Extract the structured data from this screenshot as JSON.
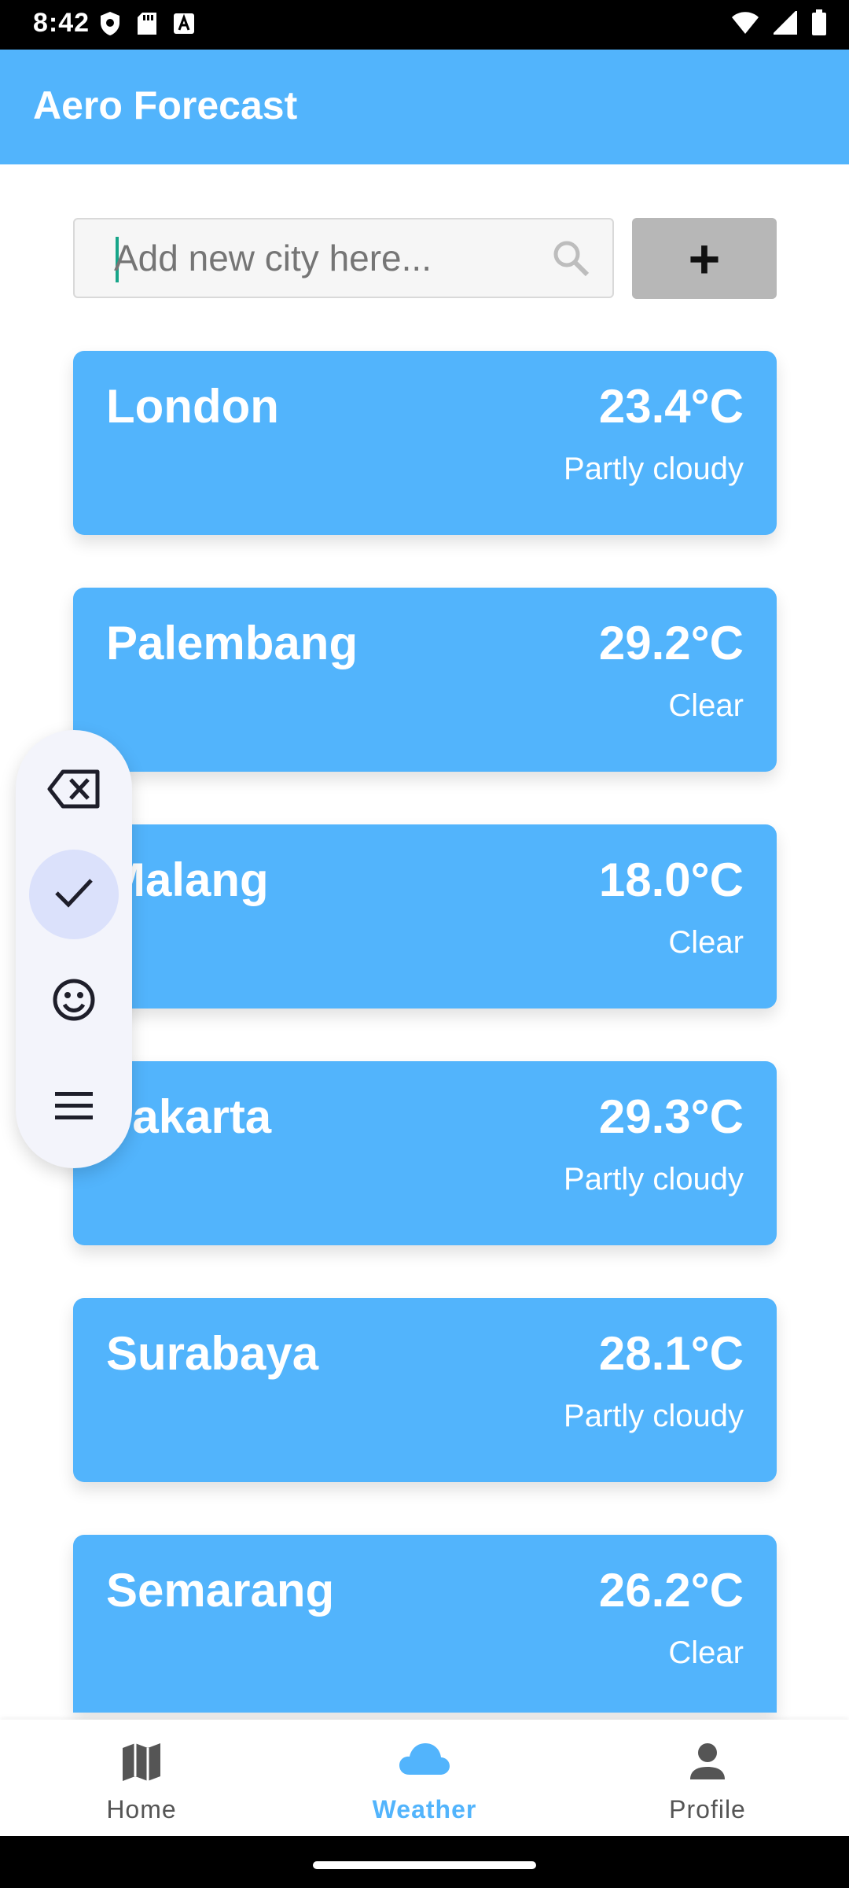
{
  "status_bar": {
    "time": "8:42",
    "left_icons": [
      "shield-icon",
      "sd-card-icon",
      "font-a-icon"
    ],
    "right_icons": [
      "wifi-icon",
      "signal-icon",
      "battery-icon"
    ]
  },
  "app": {
    "title": "Aero Forecast",
    "accent_color": "#52b4fc"
  },
  "search": {
    "placeholder": "Add new city here...",
    "value": "",
    "icon": "search-icon",
    "add_button_label": "+"
  },
  "cities": [
    {
      "name": "London",
      "temp": "23.4°C",
      "condition": "Partly cloudy"
    },
    {
      "name": "Palembang",
      "temp": "29.2°C",
      "condition": "Clear"
    },
    {
      "name": "Malang",
      "temp": "18.0°C",
      "condition": "Clear"
    },
    {
      "name": "Jakarta",
      "temp": "29.3°C",
      "condition": "Partly cloudy"
    },
    {
      "name": "Surabaya",
      "temp": "28.1°C",
      "condition": "Partly cloudy"
    },
    {
      "name": "Semarang",
      "temp": "26.2°C",
      "condition": "Clear"
    }
  ],
  "floating_panel": {
    "items": [
      "backspace-icon",
      "check-icon",
      "emoji-icon",
      "menu-icon"
    ],
    "active_index": 1
  },
  "bottom_nav": {
    "items": [
      {
        "label": "Home",
        "icon": "map-icon"
      },
      {
        "label": "Weather",
        "icon": "cloud-icon"
      },
      {
        "label": "Profile",
        "icon": "person-icon"
      }
    ],
    "active": "Weather"
  }
}
